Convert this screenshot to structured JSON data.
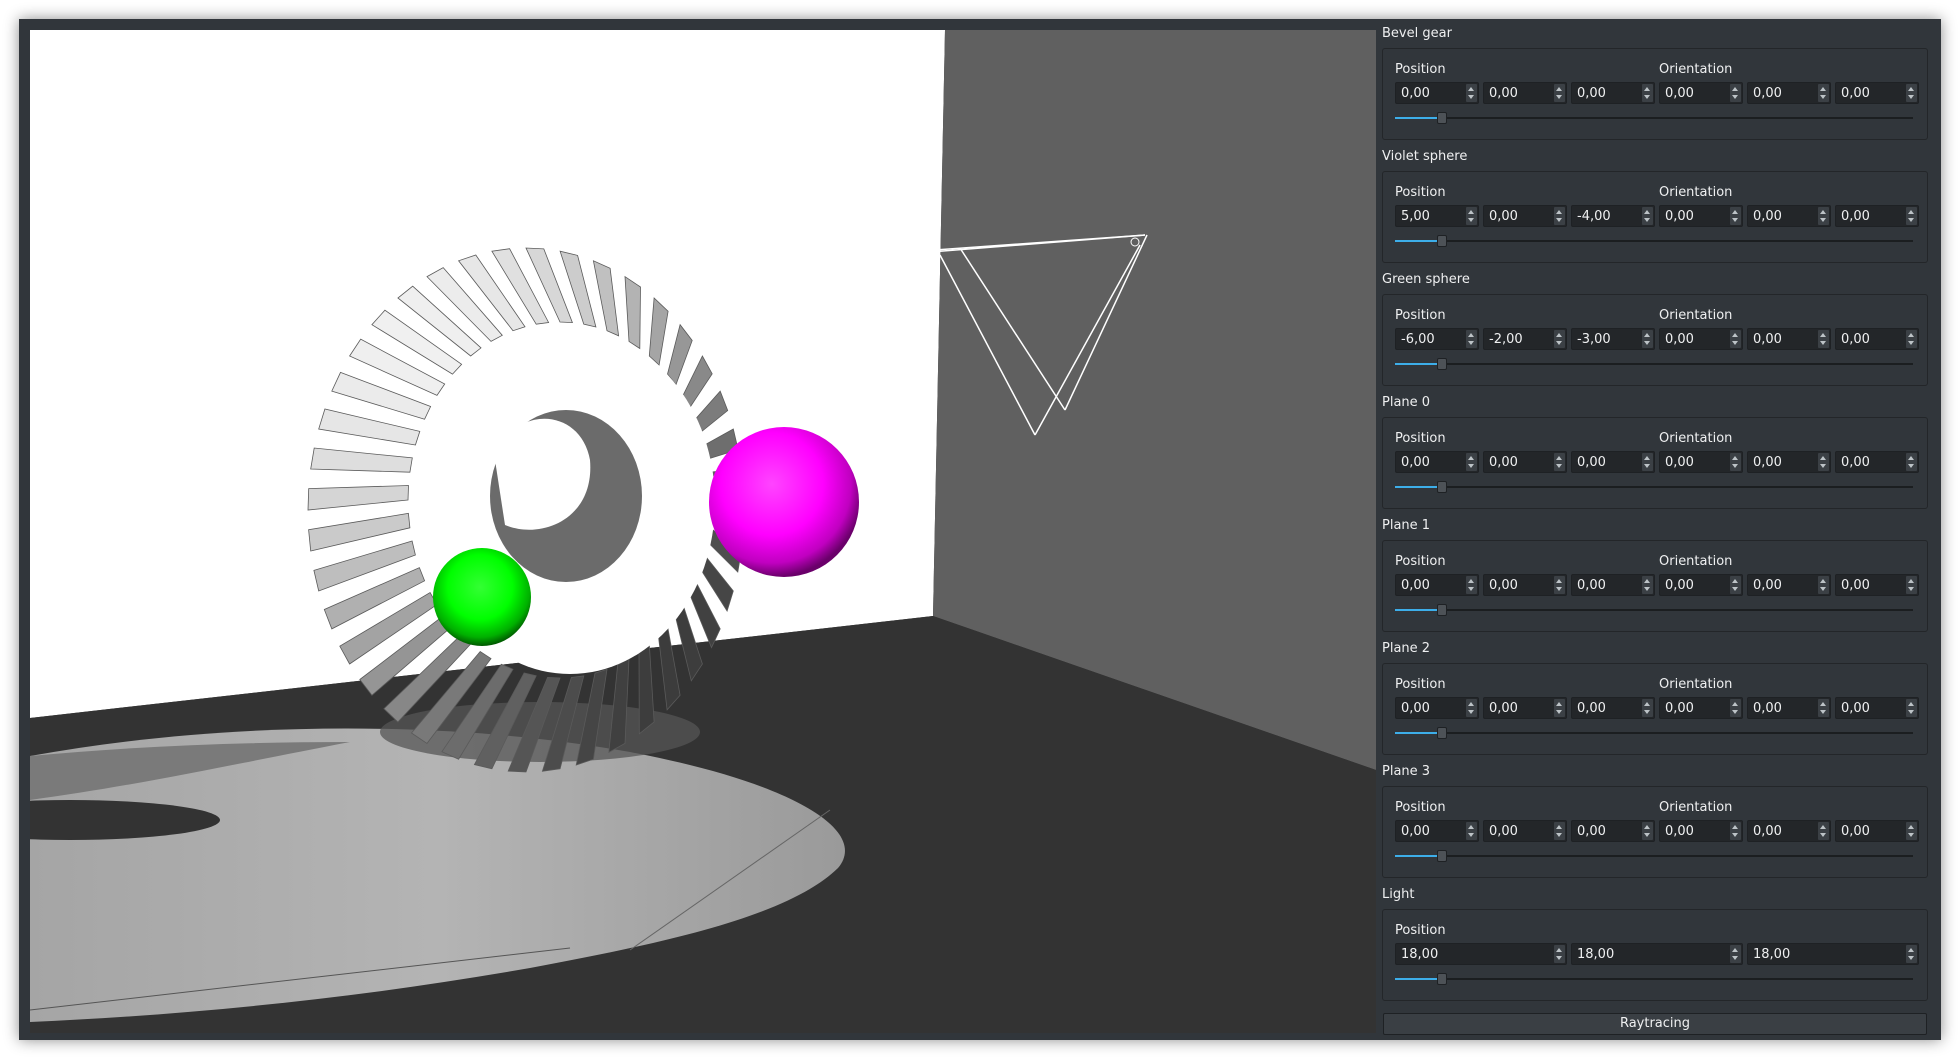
{
  "panel": {
    "groups": [
      {
        "title": "Bevel gear",
        "position_label": "Position",
        "orientation_label": "Orientation",
        "position": [
          "0,00",
          "0,00",
          "0,00"
        ],
        "orientation": [
          "0,00",
          "0,00",
          "0,00"
        ],
        "slider_value": 0.09
      },
      {
        "title": "Violet sphere",
        "position_label": "Position",
        "orientation_label": "Orientation",
        "position": [
          "5,00",
          "0,00",
          "-4,00"
        ],
        "orientation": [
          "0,00",
          "0,00",
          "0,00"
        ],
        "slider_value": 0.09
      },
      {
        "title": "Green sphere",
        "position_label": "Position",
        "orientation_label": "Orientation",
        "position": [
          "-6,00",
          "-2,00",
          "-3,00"
        ],
        "orientation": [
          "0,00",
          "0,00",
          "0,00"
        ],
        "slider_value": 0.09
      },
      {
        "title": "Plane 0",
        "position_label": "Position",
        "orientation_label": "Orientation",
        "position": [
          "0,00",
          "0,00",
          "0,00"
        ],
        "orientation": [
          "0,00",
          "0,00",
          "0,00"
        ],
        "slider_value": 0.09
      },
      {
        "title": "Plane 1",
        "position_label": "Position",
        "orientation_label": "Orientation",
        "position": [
          "0,00",
          "0,00",
          "0,00"
        ],
        "orientation": [
          "0,00",
          "0,00",
          "0,00"
        ],
        "slider_value": 0.09
      },
      {
        "title": "Plane 2",
        "position_label": "Position",
        "orientation_label": "Orientation",
        "position": [
          "0,00",
          "0,00",
          "0,00"
        ],
        "orientation": [
          "0,00",
          "0,00",
          "0,00"
        ],
        "slider_value": 0.09
      },
      {
        "title": "Plane 3",
        "position_label": "Position",
        "orientation_label": "Orientation",
        "position": [
          "0,00",
          "0,00",
          "0,00"
        ],
        "orientation": [
          "0,00",
          "0,00",
          "0,00"
        ],
        "slider_value": 0.09
      }
    ],
    "light": {
      "title": "Light",
      "position_label": "Position",
      "position": [
        "18,00",
        "18,00",
        "18,00"
      ],
      "slider_value": 0.09
    },
    "raytracing_button": "Raytracing"
  },
  "scene": {
    "objects": [
      "bevel-gear",
      "violet-sphere",
      "green-sphere",
      "light-marker",
      "back-wall",
      "side-wall",
      "floor"
    ],
    "colors": {
      "back_wall": "#ffffff",
      "side_wall": "#606060",
      "floor": "#333333",
      "sphere_violet": "#ff00ff",
      "sphere_green": "#00ff00",
      "gear": "#d6d6d6"
    }
  }
}
